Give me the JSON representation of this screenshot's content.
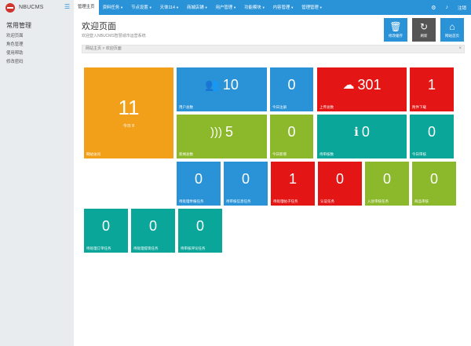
{
  "brand": {
    "name": "NBUCMS"
  },
  "nav": {
    "items": [
      {
        "label": "管理主页",
        "active": true,
        "caret": false
      },
      {
        "label": "资料任务",
        "caret": true
      },
      {
        "label": "节点设置",
        "caret": true
      },
      {
        "label": "天体114",
        "caret": true
      },
      {
        "label": "商城店铺",
        "caret": true
      },
      {
        "label": "用户管理",
        "caret": true
      },
      {
        "label": "功能模块",
        "caret": true
      },
      {
        "label": "内容管理",
        "caret": true
      },
      {
        "label": "管理管理",
        "caret": true
      }
    ],
    "right": {
      "user_label": "注销"
    }
  },
  "sidebar": {
    "title": "常用管理",
    "items": [
      "欢迎页面",
      "角色管理",
      "使用帮助",
      "修改密码"
    ]
  },
  "header": {
    "title": "欢迎页面",
    "subtitle": "欢迎登入NBUCMS智慧城市运营系统"
  },
  "quick_buttons": [
    {
      "label": "修改缓存",
      "icon": "trash-icon",
      "glyph": "🗑"
    },
    {
      "label": "刷新",
      "icon": "refresh-icon",
      "glyph": "↻"
    },
    {
      "label": "网站首页",
      "icon": "home-icon",
      "glyph": "⌂"
    }
  ],
  "breadcrumb": {
    "text": "网站主页 > 欢迎页面",
    "close": "×"
  },
  "tiles": {
    "main": {
      "value": "11",
      "sub": "今日 8",
      "label": "网站访问"
    },
    "users": {
      "value": "10",
      "label": "用户总数",
      "icon": "users-icon"
    },
    "today_users": {
      "value": "0",
      "label": "今日注册"
    },
    "cloud": {
      "value": "301",
      "label": "上传总数",
      "icon": "cloud-upload-icon"
    },
    "downloads": {
      "value": "1",
      "label": "附件下载"
    },
    "rss": {
      "value": "5",
      "label": "新闻总数",
      "icon": "rss-icon"
    },
    "today_news": {
      "value": "0",
      "label": "今日新增"
    },
    "info": {
      "value": "0",
      "label": "待审核数",
      "icon": "info-icon"
    },
    "today_review": {
      "value": "0",
      "label": "今日审核"
    },
    "r3_1": {
      "value": "0",
      "label": "待处理举报任务"
    },
    "r3_2": {
      "value": "0",
      "label": "待审核信息任务"
    },
    "r3_3": {
      "value": "1",
      "label": "待处理帖子任务"
    },
    "r3_4": {
      "value": "0",
      "label": "认证任务"
    },
    "r3_5": {
      "value": "0",
      "label": "入驻审核任务"
    },
    "r3_6": {
      "value": "0",
      "label": "商品审核"
    },
    "r4_1": {
      "value": "0",
      "label": "待处理订单任务"
    },
    "r4_2": {
      "value": "0",
      "label": "待处理提现任务"
    },
    "r4_3": {
      "value": "0",
      "label": "待审核评论任务"
    }
  },
  "colors": {
    "primary": "#2a93d8",
    "orange": "#f2a019",
    "red": "#e31515",
    "green": "#8cb82b",
    "teal": "#0aa69a",
    "sidebar": "#e9ecef"
  }
}
